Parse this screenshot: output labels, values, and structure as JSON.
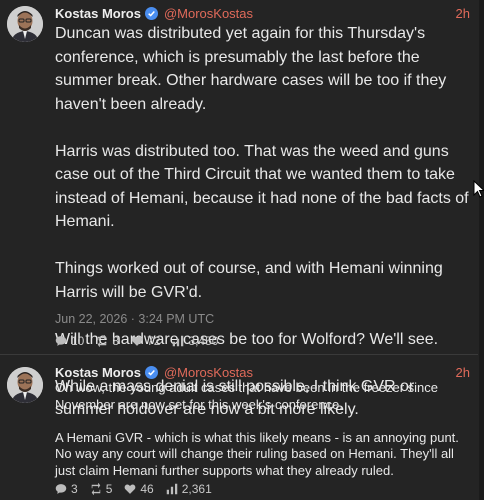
{
  "colors": {
    "accent": "#e06a5a",
    "background": "#242424",
    "verified": "#4a8ef0"
  },
  "posts": [
    {
      "author": "Kostas Moros",
      "handle": "@MorosKostas",
      "time": "2h",
      "paragraphs": [
        "Duncan was distributed yet again for this Thursday's conference, which is presumably the last before the summer break. Other hardware cases will be too if they haven't been already.",
        "Harris was distributed too. That was the weed and guns case out of the Third Circuit that we wanted them to take instead of Hemani, because it had none of the bad facts of Hemani.",
        "Things worked out of course, and with Hemani winning Harris will be GVR'd.",
        "Will the hardware cases be too for Wolford? We'll see.",
        "While a mass denial is still possible, I think GVR or summer holdover are now a bit more likely."
      ],
      "date": "Jun 22, 2026 · 3:24 PM UTC",
      "stats": {
        "replies": "10",
        "retweets": "8",
        "likes": "72",
        "views": "3,450"
      }
    },
    {
      "author": "Kostas Moros",
      "handle": "@MorosKostas",
      "time": "2h",
      "paragraphs": [
        "Oh wow, the young adult cases that have been in the freezer since November are now set for this week's conference.",
        "A Hemani GVR - which is what this likely means - is an annoying punt. No way any court will change their ruling based on Hemani. They'll all just claim Hemani further supports what they already ruled."
      ],
      "stats": {
        "replies": "3",
        "retweets": "5",
        "likes": "46",
        "views": "2,361"
      }
    }
  ]
}
